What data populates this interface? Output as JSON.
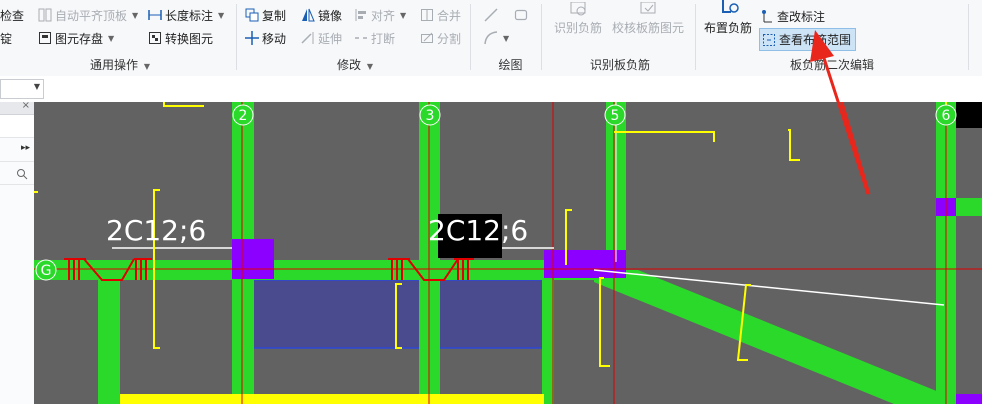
{
  "ribbon": {
    "general": {
      "check": "检查",
      "auto_flush": "自动平齐顶板",
      "length_dim": "长度标注",
      "fix": "锭",
      "save_element": "图元存盘",
      "convert_element": "转换图元",
      "group_label": "通用操作"
    },
    "modify": {
      "copy": "复制",
      "mirror": "镜像",
      "align": "对齐",
      "merge": "合并",
      "move": "移动",
      "extend": "延伸",
      "break": "打断",
      "split": "分割",
      "group_label": "修改"
    },
    "draw": {
      "group_label": "绘图"
    },
    "identify": {
      "identify_neg": "识别负筋",
      "check_rebar": "校核板筋图元",
      "group_label": "识别板负筋"
    },
    "edit": {
      "place_neg": "布置负筋",
      "check_annot": "查改标注",
      "view_range": "查看布筋范围",
      "group_label": "板负筋二次编辑"
    }
  },
  "drawing": {
    "axes": [
      "G",
      "2",
      "3",
      "5",
      "6"
    ],
    "rebar_labels": [
      "2C12;6",
      "2C12;6"
    ]
  },
  "colors": {
    "canvas_bg": "#626262",
    "beam_green": "#2bd92b",
    "purple": "#8b00ff",
    "yellow": "#ffff00",
    "red_line": "#e00000",
    "slab_blue": "#4a4a8e",
    "arrow_red": "#e8261c"
  }
}
